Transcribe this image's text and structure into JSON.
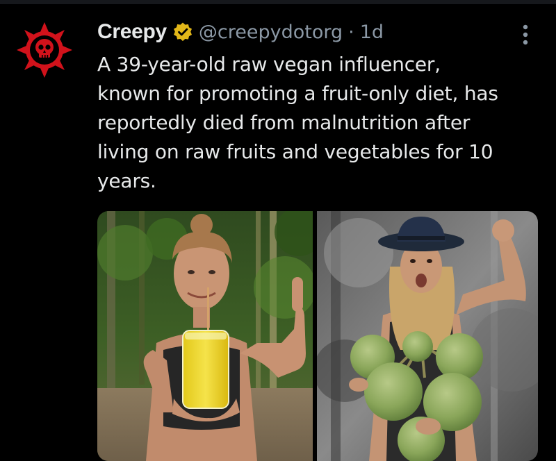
{
  "tweet": {
    "display_name": "Creepy",
    "handle": "@creepydotorg",
    "separator": "·",
    "time": "1d",
    "text": "A 39-year-old raw vegan influencer,\nknown for promoting a fruit-only diet, has\nreportedly died from malnutrition after\nliving on raw fruits and vegetables for 10\nyears.",
    "avatar_icon": "red-skull-logo-icon",
    "verified_icon": "gold-verified-badge-icon",
    "more_icon": "more-options-icon"
  },
  "colors": {
    "background": "#000000",
    "text": "#e7e9ea",
    "secondary_text": "#8b98a5",
    "avatar_red": "#d1121b",
    "verified_gold": "#e2b719"
  }
}
